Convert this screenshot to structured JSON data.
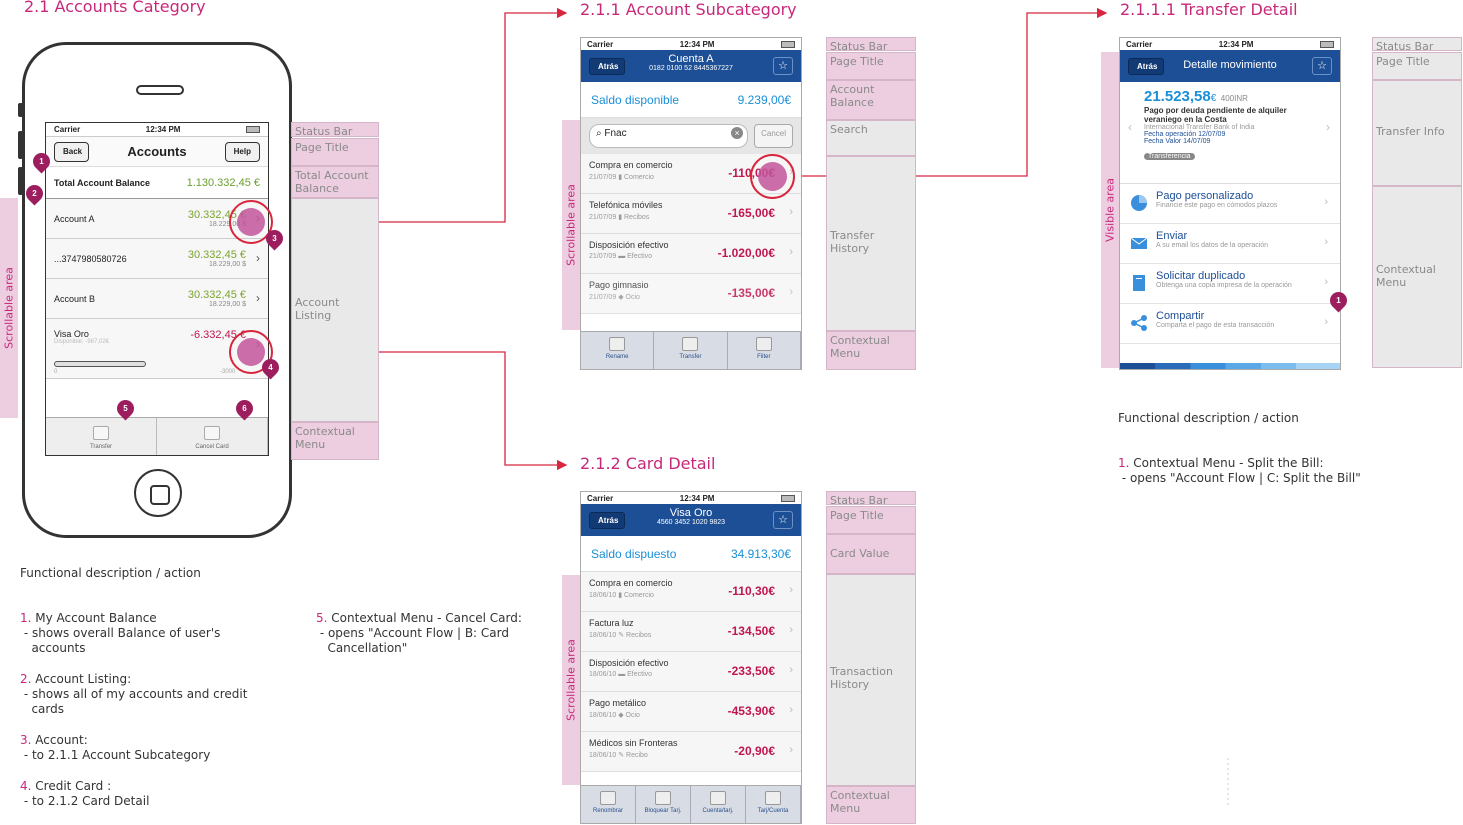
{
  "sections": {
    "s21": "2.1 Accounts Category",
    "s211": "2.1.1 Account Subcategory",
    "s2111": "2.1.1.1 Transfer Detail",
    "s212": "2.1.2 Card Detail"
  },
  "colors": {
    "accent": "#c8287a",
    "nav_blue": "#1d4f96",
    "label_pink": "#eccee0",
    "label_grey": "#e9e9e9"
  },
  "phone": {
    "status": {
      "carrier": "Carrier",
      "time": "12:34 PM"
    },
    "nav": {
      "back": "Back",
      "title": "Accounts",
      "help": "Help"
    },
    "total": {
      "label": "Total Account Balance",
      "value": "1.130.332,45 €"
    },
    "accounts": [
      {
        "name": "Account A",
        "amount": "30.332,45 €",
        "sub": "18.229,00 $"
      },
      {
        "name": "...3747980580726",
        "amount": "30.332,45 €",
        "sub": "18.229,00 $"
      },
      {
        "name": "Account B",
        "amount": "30.332,45 €",
        "sub": "18.229,00 $"
      },
      {
        "name": "Visa Oro",
        "amount": "-6.332,45 €",
        "sub": "Disponible: -987,02€",
        "bar_min": "0",
        "bar_max": "-3000"
      }
    ],
    "menu": [
      "Transfer",
      "Cancel Card"
    ],
    "scroll_label": "Scrollable area",
    "labels": [
      "Status Bar",
      "Page Title",
      "Total Account Balance",
      "Account Listing",
      "Contextual Menu"
    ]
  },
  "pins": [
    "1",
    "2",
    "3",
    "4",
    "5",
    "6"
  ],
  "sub": {
    "status": {
      "carrier": "Carrier",
      "time": "12:34 PM"
    },
    "nav": {
      "back": "Atrás",
      "title": "Cuenta A",
      "subtitle": "0182 0100 52 8445367227"
    },
    "balance": {
      "label": "Saldo disponible",
      "value": "9.239,00€"
    },
    "search": {
      "value": "Fnac",
      "cancel": "Cancel"
    },
    "rows": [
      {
        "name": "Compra en comercio",
        "date": "21/07/09",
        "cat": "Comercio",
        "amount": "-110,00€"
      },
      {
        "name": "Telefónica móviles",
        "date": "21/07/09",
        "cat": "Recibos",
        "amount": "-165,00€"
      },
      {
        "name": "Disposición efectivo",
        "date": "21/07/09",
        "cat": "Efectivo",
        "amount": "-1.020,00€"
      },
      {
        "name": "Pago gimnasio",
        "date": "21/07/09",
        "cat": "Ocio",
        "amount": "-135,00€"
      }
    ],
    "menu": [
      "Rename",
      "Transfer",
      "Filter"
    ],
    "scroll_label": "Scrollable  area",
    "labels": [
      "Status Bar",
      "Page Title",
      "Account Balance",
      "Search",
      "Transfer History",
      "Contextual Menu"
    ]
  },
  "card": {
    "status": {
      "carrier": "Carrier",
      "time": "12:34 PM"
    },
    "nav": {
      "back": "Atrás",
      "title": "Visa Oro",
      "subtitle": "4560 3452 1020 9823"
    },
    "balance": {
      "label": "Saldo dispuesto",
      "value": "34.913,30€"
    },
    "rows": [
      {
        "name": "Compra en comercio",
        "date": "18/06/10",
        "cat": "Comercio",
        "amount": "-110,30€"
      },
      {
        "name": "Factura luz",
        "date": "18/06/10",
        "cat": "Recibos",
        "amount": "-134,50€"
      },
      {
        "name": "Disposición efectivo",
        "date": "18/06/10",
        "cat": "Efectivo",
        "amount": "-233,50€"
      },
      {
        "name": "Pago metálico",
        "date": "18/06/10",
        "cat": "Ocio",
        "amount": "-453,90€"
      },
      {
        "name": "Médicos sin Fronteras",
        "date": "18/06/10",
        "cat": "Recibo",
        "amount": "-20,90€"
      }
    ],
    "menu": [
      "Renombrar",
      "Bloquear Tarj.",
      "Cuenta/tarj.",
      "Tarj/Cuenta"
    ],
    "scroll_label": "Scrollable  area",
    "labels": [
      "Status Bar",
      "Page Title",
      "Card Value",
      "Transaction History",
      "Contextual Menu"
    ]
  },
  "detail": {
    "status": {
      "carrier": "Carrier",
      "time": "12:34 PM"
    },
    "nav": {
      "back": "Atrás",
      "title": "Detalle movimiento"
    },
    "info": {
      "amount": "21.523,58",
      "currency": "€",
      "inr": "400INR",
      "desc": "Pago por deuda pendiente de alquiler veraniego en la Costa",
      "bank": "Internacional Transfer Bank of India",
      "op_date": "Fecha operación 12/07/09",
      "val_date": "Fecha Valor 14/07/09",
      "tag": "Transferencia"
    },
    "actions": [
      {
        "title": "Pago personalizado",
        "desc": "Financie este pago en cómodos plazos"
      },
      {
        "title": "Enviar",
        "desc": "A su email los datos de la operación"
      },
      {
        "title": "Solicitar duplicado",
        "desc": "Obtenga una copia impresa de la operación"
      },
      {
        "title": "Compartir",
        "desc": "Comparta el pago de esta transacción"
      }
    ],
    "visible_label": "Visible  area",
    "labels": [
      "Status Bar",
      "Page Title",
      "Transfer Info",
      "Contextual Menu"
    ]
  },
  "desc1": {
    "heading": "Functional description / action",
    "items": [
      {
        "n": "1.",
        "text": "My Account Balance\n - shows overall Balance of user's\n   accounts"
      },
      {
        "n": "2.",
        "text": "Account Listing:\n - shows all of my accounts and credit\n   cards"
      },
      {
        "n": "3.",
        "text": "Account:\n - to 2.1.1 Account Subcategory"
      },
      {
        "n": "4.",
        "text": "Credit Card :\n - to 2.1.2 Card Detail"
      },
      {
        "n": "5.",
        "text": "Contextual Menu - Cancel Card:\n - opens \"Account Flow | B: Card\n   Cancellation\""
      }
    ]
  },
  "desc2": {
    "heading": "Functional description / action",
    "items": [
      {
        "n": "1.",
        "text": "Contextual Menu - Split the Bill:\n - opens \"Account Flow | C: Split the Bill\""
      }
    ]
  }
}
